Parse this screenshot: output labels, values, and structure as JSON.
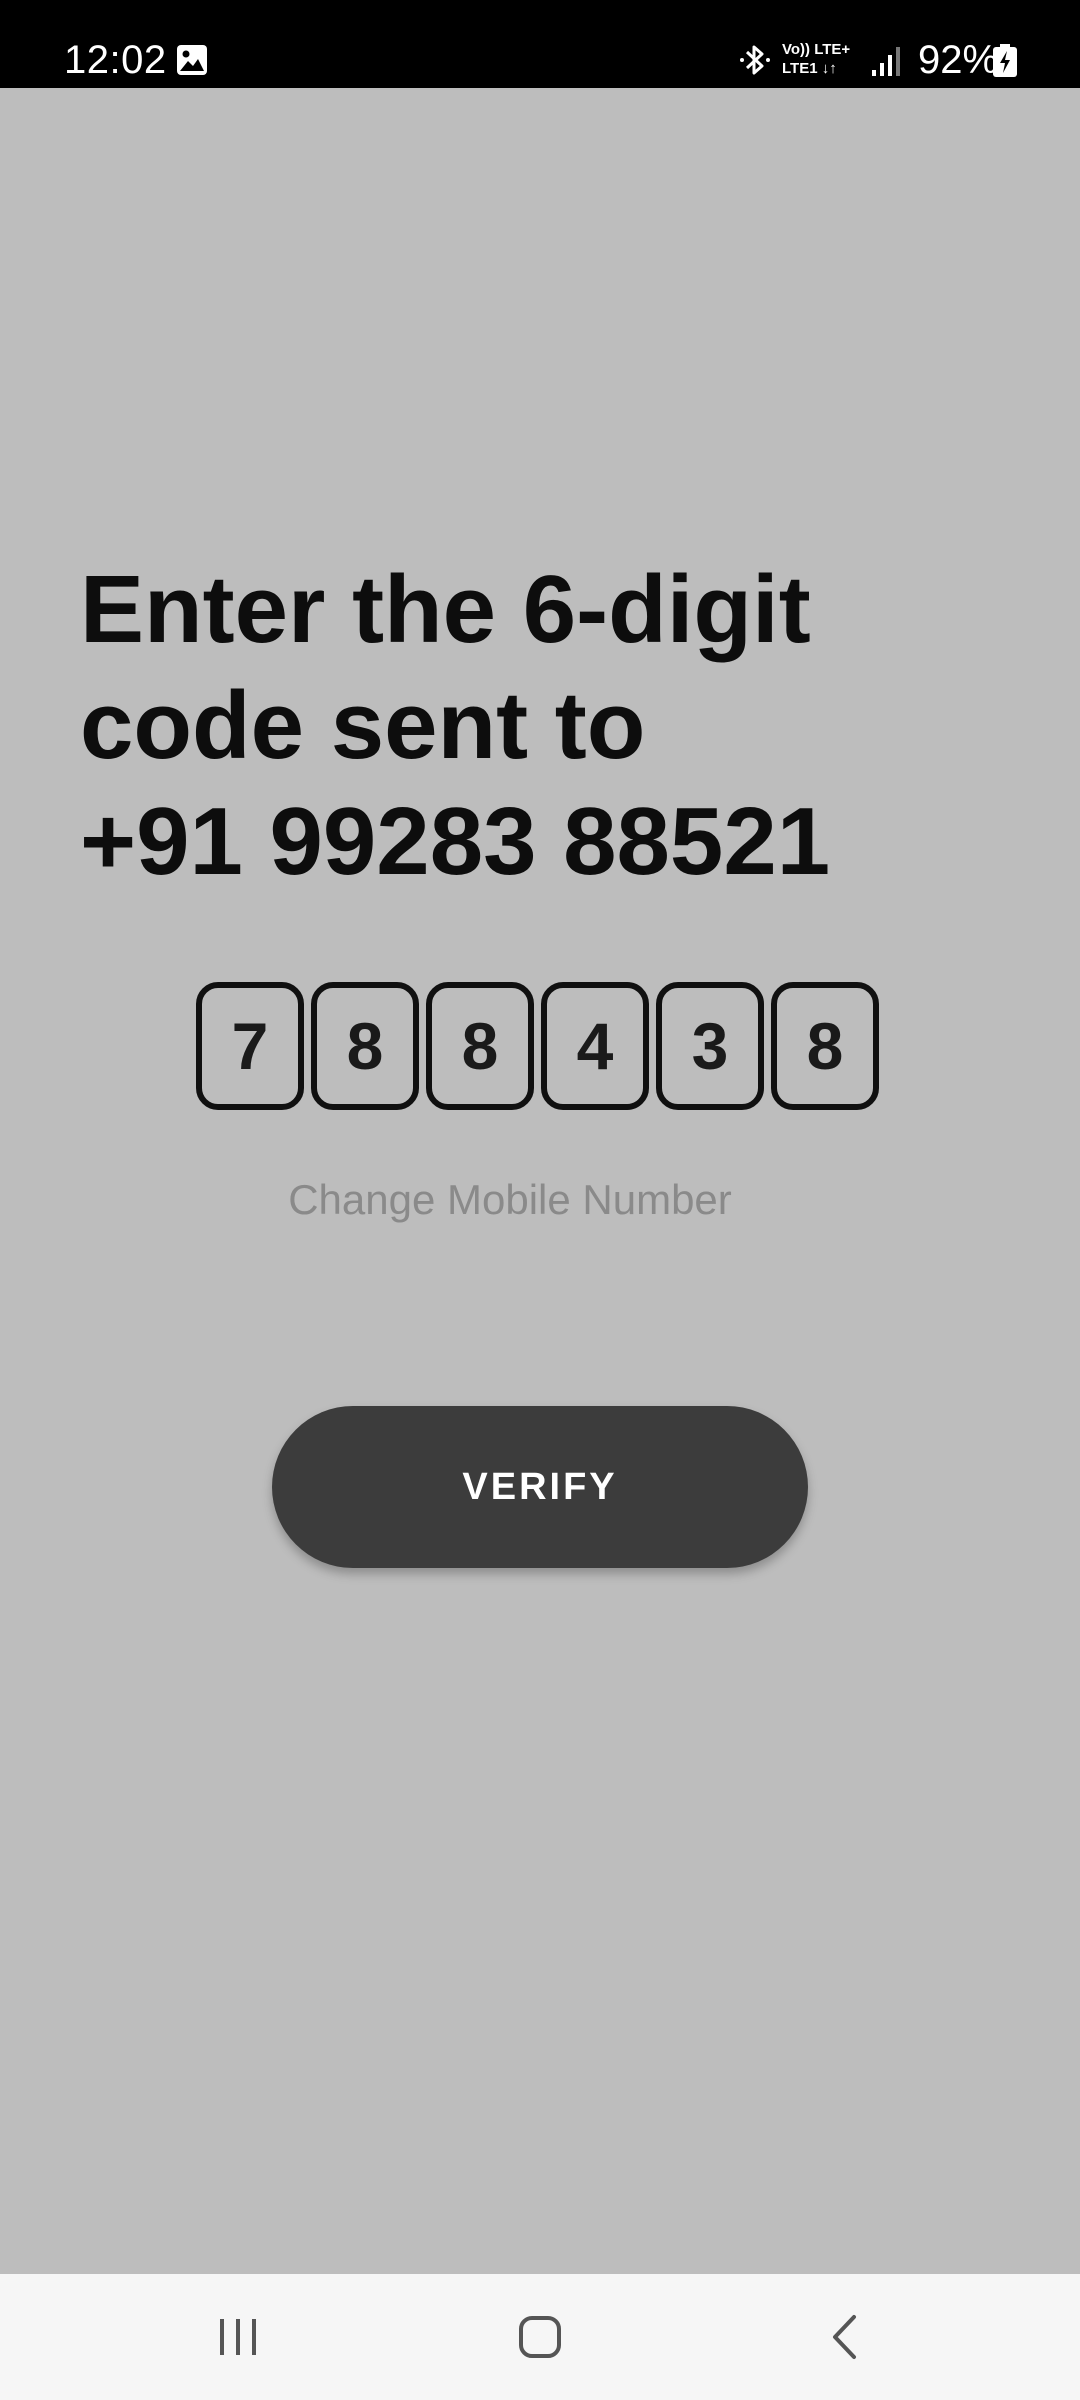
{
  "status_bar": {
    "time": "12:02",
    "net_line1": "Vo)) LTE+",
    "net_line2": "LTE1 ↓↑",
    "battery": "92%",
    "icons": [
      "gallery-icon",
      "bluetooth-icon",
      "signal-icon",
      "battery-charging-icon"
    ]
  },
  "otp": {
    "heading_line1": "Enter the 6-digit",
    "heading_line2": "code sent to",
    "heading_line3": "+91 99283 88521",
    "digits": [
      "7",
      "8",
      "8",
      "4",
      "3",
      "8"
    ],
    "change_link": "Change Mobile Number",
    "verify_label": "VERIFY"
  },
  "nav_bar": {
    "icons": [
      "recent-apps-icon",
      "home-icon",
      "back-icon"
    ]
  },
  "colors": {
    "background": "#bdbdbd",
    "button": "#3c3c3c",
    "link": "#8a8a8a",
    "nav_bar": "#f6f6f6"
  }
}
